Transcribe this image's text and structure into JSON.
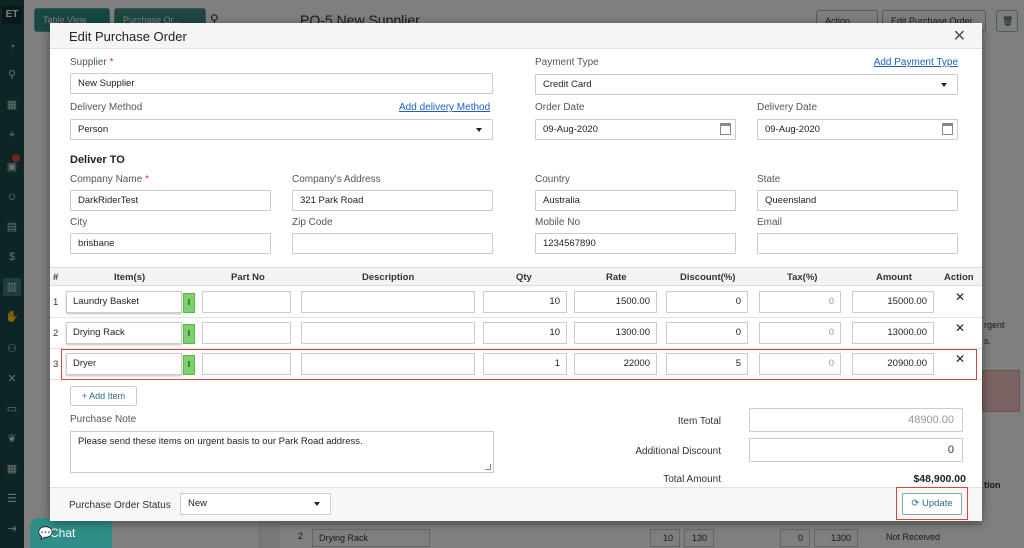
{
  "background": {
    "logo": "ET",
    "table_view_label": "Table View",
    "purchase_order_tab": "Purchase Or...",
    "page_title": "PO-5 New Supplier",
    "action_label": "Action",
    "edit_po_label": "Edit Purchase Order",
    "side_text_1": "rgent",
    "side_text_2": "s.",
    "side_text_3": "tion",
    "bottom_row": {
      "num": "2",
      "item": "Drying Rack",
      "col_a": "10",
      "col_b": "130",
      "col_c": "0",
      "col_d": "1300",
      "status": "Not Received"
    }
  },
  "chat": {
    "label": "Chat"
  },
  "modal": {
    "title": "Edit Purchase Order",
    "supplier": {
      "label": "Supplier",
      "required": "*",
      "value": "New Supplier"
    },
    "payment_type": {
      "label": "Payment Type",
      "link": "Add Payment Type",
      "value": "Credit Card"
    },
    "delivery_method": {
      "label": "Delivery Method",
      "link": "Add delivery Method",
      "value": "Person"
    },
    "order_date": {
      "label": "Order Date",
      "value": "09-Aug-2020"
    },
    "delivery_date": {
      "label": "Delivery Date",
      "value": "09-Aug-2020"
    },
    "deliver_to": {
      "title": "Deliver TO",
      "company_name": {
        "label": "Company Name",
        "required": "*",
        "value": "DarkRiderTest"
      },
      "company_address": {
        "label": "Company's Address",
        "value": "321 Park Road"
      },
      "country": {
        "label": "Country",
        "value": "Australia"
      },
      "state": {
        "label": "State",
        "value": "Queensland"
      },
      "city": {
        "label": "City",
        "value": "brisbane"
      },
      "zip": {
        "label": "Zip Code",
        "value": ""
      },
      "mobile": {
        "label": "Mobile No",
        "value": "1234567890"
      },
      "email": {
        "label": "Email",
        "value": ""
      }
    },
    "table": {
      "headers": [
        "#",
        "Item(s)",
        "Part No",
        "Description",
        "Qty",
        "Rate",
        "Discount(%)",
        "Tax(%)",
        "Amount",
        "Action"
      ],
      "rows": [
        {
          "num": "1",
          "item": "Laundry Basket",
          "part": "",
          "desc": "",
          "qty": "10",
          "rate": "1500.00",
          "discount": "0",
          "tax": "0",
          "amount": "15000.00"
        },
        {
          "num": "2",
          "item": "Drying Rack",
          "part": "",
          "desc": "",
          "qty": "10",
          "rate": "1300.00",
          "discount": "0",
          "tax": "0",
          "amount": "13000.00"
        },
        {
          "num": "3",
          "item": "Dryer",
          "part": "",
          "desc": "",
          "qty": "1",
          "rate": "22000",
          "discount": "5",
          "tax": "0",
          "amount": "20900.00"
        }
      ],
      "green_marker": "I",
      "delete_glyph": "✕"
    },
    "add_item_label": "Add Item",
    "purchase_note": {
      "label": "Purchase Note",
      "value": "Please send these items on urgent basis to our Park Road address."
    },
    "totals": {
      "item_total_label": "Item Total",
      "item_total": "48900.00",
      "additional_discount_label": "Additional Discount",
      "additional_discount": "0",
      "total_amount_label": "Total Amount",
      "total_amount": "$48,900.00"
    },
    "status": {
      "label": "Purchase Order Status",
      "value": "New"
    },
    "update_label": "Update"
  },
  "colors": {
    "sidebar": "#1c4a4b",
    "accent": "#2f8f88",
    "highlight": "#d9453b",
    "link": "#1f5fbf"
  }
}
